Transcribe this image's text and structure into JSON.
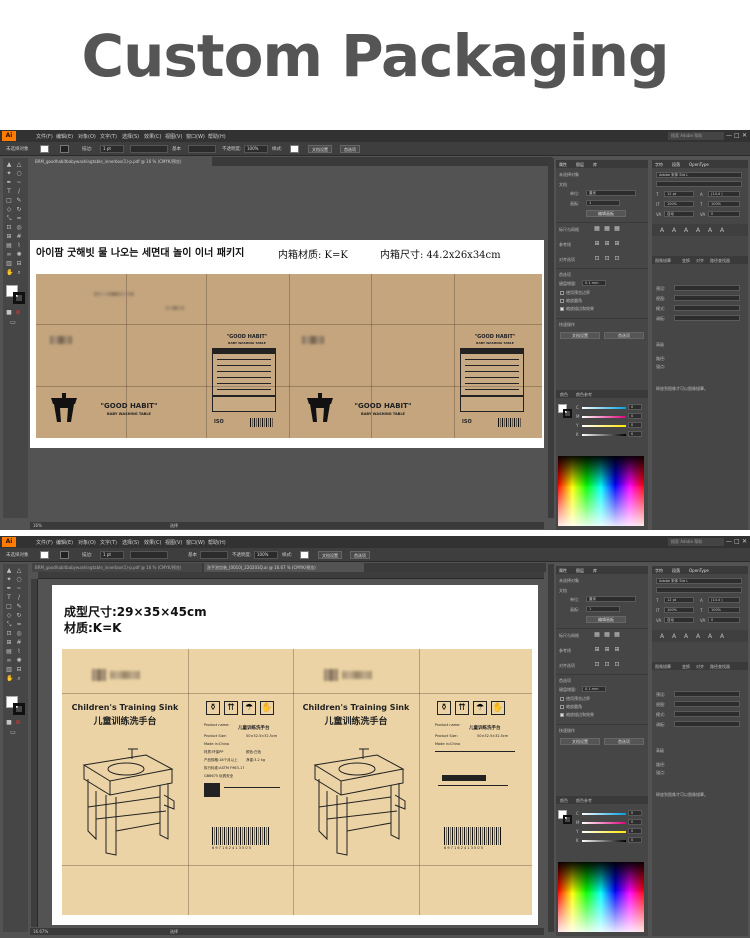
{
  "hero": {
    "title": "Custom Packaging"
  },
  "app": {
    "logo": "Ai",
    "menu": [
      "文件(F)",
      "编辑(E)",
      "对象(O)",
      "文字(T)",
      "选择(S)",
      "效果(C)",
      "视图(V)",
      "窗口(W)",
      "帮助(H)"
    ],
    "search_placeholder": "搜索 Adobe 帮助",
    "window_buttons": [
      "—",
      "□",
      "✕"
    ]
  },
  "control_bar": {
    "no_selection": "未选择对象",
    "stroke_label": "描边:",
    "stroke_value": "1 pt",
    "uniform": "基本",
    "opacity_label": "不透明度:",
    "opacity_value": "100%",
    "style_label": "样式:",
    "doc_setup": "文档设置",
    "prefs": "首选项"
  },
  "window1": {
    "tab": "BRM_goodhabitbabywashingtable_innerbox(1)-p.pdf @ 16 % (CMYK/预览)",
    "zoom": "16%",
    "status": "选择",
    "annotation_korean": "아이팜     굿해빗 물 나오는 세면대 놀이     이너 패키지",
    "annotation_material": "内箱材质:   K=K",
    "annotation_size": "内箱尺寸: 44.2x26x34cm",
    "box_brand": "\"GOOD HABIT\"",
    "box_sub": "BABY WASHING TABLE",
    "label_title": "\"GOOD HABIT\"",
    "label_sub": "BABY WASHING TABLE",
    "iso": "ISO"
  },
  "window2": {
    "tabs": [
      "BRM_goodhabitbabywashingtable_innerbox(1)-p.pdf @ 16 % (CMYK/预览)",
      "洗手池包装_(0010)_220203Q.ai @ 16.67 % (CMYK/预览)"
    ],
    "zoom": "16.67%",
    "status": "选择",
    "annotation_size": "成型尺寸:29×35×45cm",
    "annotation_material": "材质:K=K",
    "product_en": "Children's Training Sink",
    "product_cn": "儿童训练洗手台",
    "label_fields": [
      {
        "k": "Product name:",
        "v": "儿童训练洗手台"
      },
      {
        "k": "Product Size:",
        "v": "50×32.5×32.5cm"
      },
      {
        "k": "Made in:China",
        "v": ""
      },
      {
        "k": "材质:环保PP",
        "v": "颜色:白色"
      },
      {
        "k": "产品规格:18个月以上",
        "v": "净重:3.2 kg"
      },
      {
        "k": "执行标准:ASTM F963-17",
        "v": ""
      },
      {
        "k": "GB6675 玩具安全",
        "v": ""
      }
    ],
    "barcode_number": "6 9 7 1 6 2 4 1 3 5 0 5"
  },
  "right_panel": {
    "tabs": [
      "属性",
      "图层",
      "库"
    ],
    "section_doc": "未选择对象",
    "doc_label": "文档",
    "unit_label": "单位:",
    "unit_value": "厘米",
    "artboard_label": "画板:",
    "artboard_value": "1",
    "edit_artboard": "编辑画板",
    "rulers_grid": "标尺与网格",
    "guides": "参考线",
    "snap": "对齐选项",
    "prefs_section": "首选项",
    "keyboard_inc": "键盘增量:",
    "keyboard_inc_value": "0.1 mm",
    "opt_scale_corners": "缩放圆角",
    "opt_scale_stroke": "缩放描边和效果",
    "opt_preview_bounds": "使用预览边界",
    "opt_scale_corner2": "缩放圆角",
    "quick_actions": "快速操作",
    "doc_setup_btn": "文档设置",
    "prefs_btn": "首选项",
    "color_tabs": [
      "颜色",
      "颜色参考"
    ],
    "cmyk": [
      {
        "k": "C",
        "v": "0"
      },
      {
        "k": "M",
        "v": "0"
      },
      {
        "k": "Y",
        "v": "0"
      },
      {
        "k": "K",
        "v": "0"
      }
    ]
  },
  "char_panel": {
    "tabs": [
      "字符",
      "段落",
      "OpenType"
    ],
    "font": "Adobe 宋体 Std L",
    "size": "12 pt",
    "leading": "(14.4 )",
    "scale_v": "100%",
    "scale_h": "100%",
    "tracking": "0",
    "kerning": "自动",
    "para_tabs": [
      "图像描摹",
      "变换",
      "对齐",
      "路径查找器"
    ],
    "preset": "预设:",
    "view": "视图:",
    "mode": "模式:",
    "palette": "调板:",
    "advanced": "高级",
    "paths": "路径:",
    "anchors": "锚点:",
    "no_image": "释放到图像才可以图像描摹。"
  },
  "colors": {
    "app_bg": "#535353",
    "menubar": "#323232",
    "kraft": "#c4a57e",
    "kraft_light": "#ebd3a5",
    "accent": "#ff7c00"
  }
}
